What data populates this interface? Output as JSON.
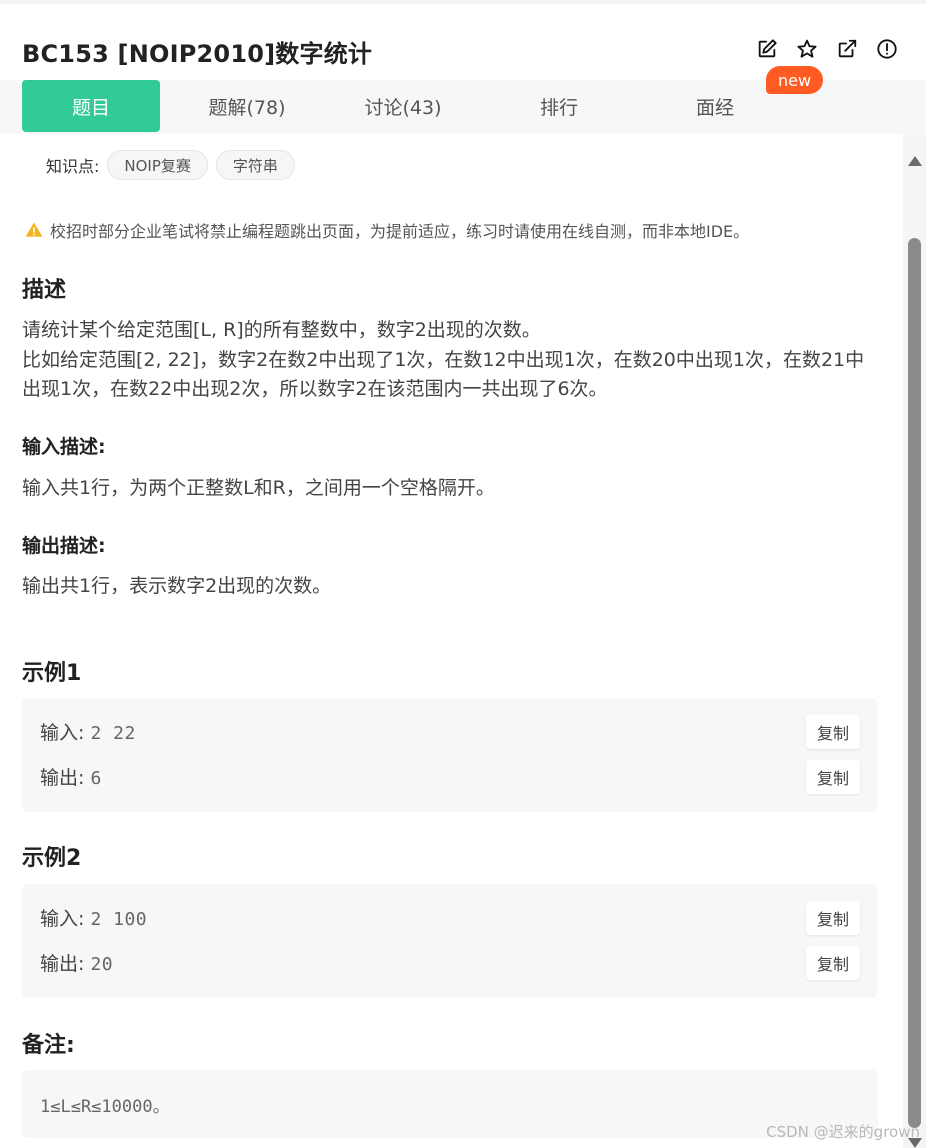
{
  "header": {
    "title": "BC153  [NOIP2010]数字统计",
    "actions": [
      {
        "icon": "edit-icon"
      },
      {
        "icon": "star-icon"
      },
      {
        "icon": "share-icon"
      },
      {
        "icon": "info-icon"
      }
    ]
  },
  "tabs": [
    {
      "label": "题目",
      "active": true
    },
    {
      "label": "题解(78)",
      "active": false
    },
    {
      "label": "讨论(43)",
      "active": false
    },
    {
      "label": "排行",
      "active": false
    },
    {
      "label": "面经",
      "active": false
    }
  ],
  "new_badge": "new",
  "knowledge": {
    "label": "知识点:",
    "tags": [
      "NOIP复赛",
      "字符串"
    ]
  },
  "warning": {
    "text": "校招时部分企业笔试将禁止编程题跳出页面，为提前适应，练习时请使用在线自测，而非本地IDE。",
    "color": "#f2b418"
  },
  "description": {
    "title": "描述",
    "line1": "请统计某个给定范围[L, R]的所有整数中，数字2出现的次数。",
    "line2": "比如给定范围[2, 22]，数字2在数2中出现了1次，在数12中出现1次，在数20中出现1次，在数21中出现1次，在数22中出现2次，所以数字2在该范围内一共出现了6次。"
  },
  "input_desc": {
    "title": "输入描述:",
    "text": "输入共1行，为两个正整数L和R，之间用一个空格隔开。"
  },
  "output_desc": {
    "title": "输出描述:",
    "text": "输出共1行，表示数字2出现的次数。"
  },
  "examples": [
    {
      "title": "示例1",
      "input_label": "输入:",
      "input_value": "2 22",
      "output_label": "输出:",
      "output_value": "6",
      "copy_label": "复制"
    },
    {
      "title": "示例2",
      "input_label": "输入:",
      "input_value": "2 100",
      "output_label": "输出:",
      "output_value": "20",
      "copy_label": "复制"
    }
  ],
  "note": {
    "title": "备注:",
    "text": "1≤L≤R≤10000。"
  },
  "watermark": "CSDN @迟来的grown",
  "colors": {
    "accent": "#32ca99",
    "badge": "#ff5b22"
  }
}
